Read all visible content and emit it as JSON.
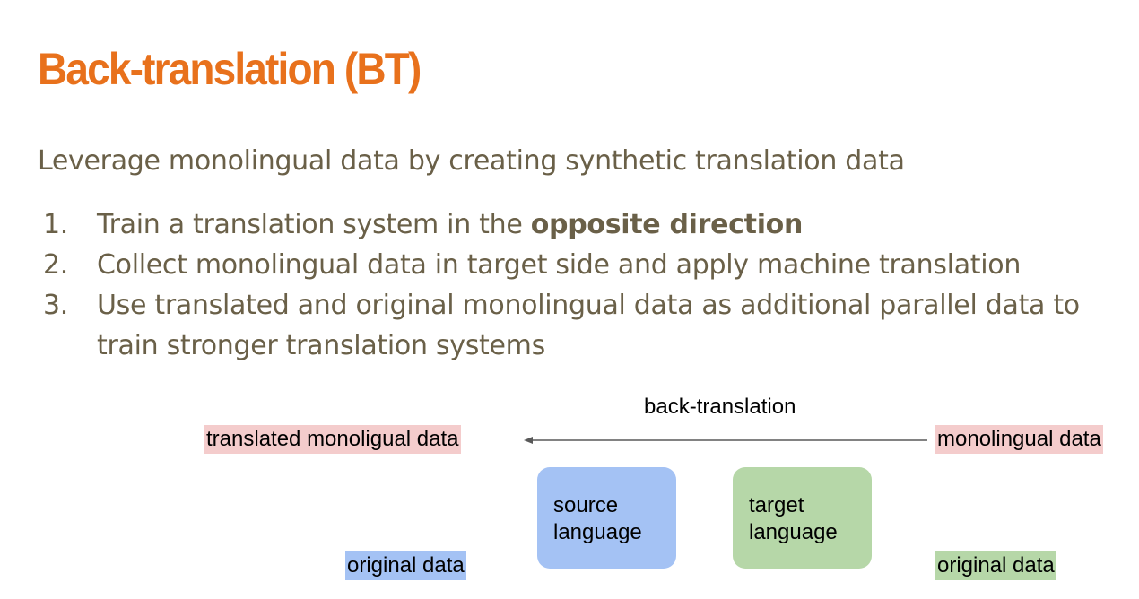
{
  "slide": {
    "title": "Back-translation (BT)",
    "subtitle": "Leverage monolingual data by creating synthetic translation data",
    "steps": [
      {
        "num": "1.",
        "text": "Train a translation system in the ",
        "bold": "opposite direction"
      },
      {
        "num": "2.",
        "text": "Collect monolingual data in target side and apply machine translation"
      },
      {
        "num": "3.",
        "text": "Use translated and original monolingual data as additional parallel data to train stronger translation systems"
      }
    ]
  },
  "diagram": {
    "arrow_label": "back-translation",
    "translated_label": "translated monoligual data",
    "monolingual_label": "monolingual data",
    "source_box": {
      "line1": "source",
      "line2": "language"
    },
    "target_box": {
      "line1": "target",
      "line2": "language"
    },
    "original_source_label": "original data",
    "original_target_label": "original data"
  },
  "colors": {
    "title": "#e8711c",
    "body_text": "#6a6048",
    "pink_highlight": "#f4cccc",
    "blue": "#a4c2f4",
    "green": "#b6d7a8"
  }
}
